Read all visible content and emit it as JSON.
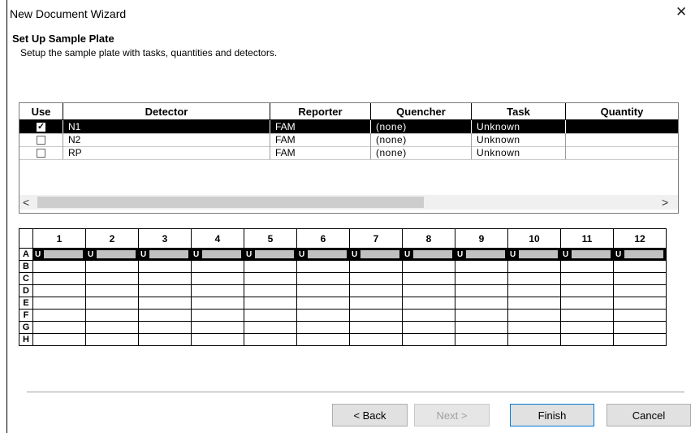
{
  "window": {
    "title": "New Document Wizard"
  },
  "header": {
    "heading": "Set Up Sample Plate",
    "subheading": "Setup the sample plate with tasks, quantities and detectors."
  },
  "detector_table": {
    "columns": [
      "Use",
      "Detector",
      "Reporter",
      "Quencher",
      "Task",
      "Quantity"
    ],
    "rows": [
      {
        "use": true,
        "detector": "N1",
        "reporter": "FAM",
        "quencher": "(none)",
        "task": "Unknown",
        "quantity": "",
        "selected": true
      },
      {
        "use": false,
        "detector": "N2",
        "reporter": "FAM",
        "quencher": "(none)",
        "task": "Unknown",
        "quantity": "",
        "selected": false
      },
      {
        "use": false,
        "detector": "RP",
        "reporter": "FAM",
        "quencher": "(none)",
        "task": "Unknown",
        "quantity": "",
        "selected": false
      }
    ],
    "scroll_left": "<",
    "scroll_right": ">"
  },
  "plate": {
    "columns": [
      "1",
      "2",
      "3",
      "4",
      "5",
      "6",
      "7",
      "8",
      "9",
      "10",
      "11",
      "12"
    ],
    "rows": [
      "A",
      "B",
      "C",
      "D",
      "E",
      "F",
      "G",
      "H"
    ],
    "well_label": "U",
    "filled_row": "A"
  },
  "buttons": {
    "back": "< Back",
    "next": "Next >",
    "finish": "Finish",
    "cancel": "Cancel"
  },
  "icons": {
    "close": "close-icon",
    "checkbox": "checkbox-icon"
  },
  "colors": {
    "selected_row": "#000000",
    "well_bar": "#c0c0c0"
  }
}
